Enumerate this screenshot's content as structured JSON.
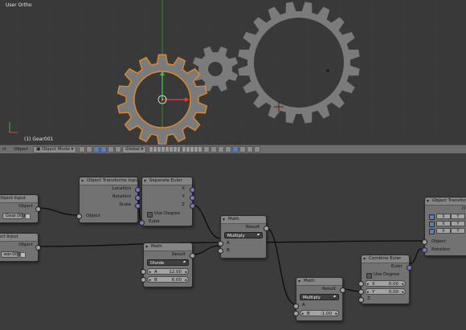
{
  "viewport": {
    "view_label": "User Ortho",
    "object_label": "(1) Gear001"
  },
  "header": {
    "menu_items": [
      "ct",
      "Object"
    ],
    "mode": "Object Mode",
    "orientation": "Global"
  },
  "nodes": {
    "object_input_1": {
      "title": "Object Input",
      "output": "Object",
      "value": "Gear.001"
    },
    "object_input_2": {
      "title": "ect Input",
      "output": "Object",
      "value": "ear.003"
    },
    "otin": {
      "title": "Object Transforms Input",
      "outputs": [
        "Location",
        "Rotation",
        "Scale"
      ],
      "input": "Object"
    },
    "separate_euler": {
      "title": "Separate Euler",
      "outputs": [
        "X",
        "Y",
        "Z"
      ],
      "checkbox": "Use Degree",
      "input": "Euler"
    },
    "math_divide": {
      "title": "Math",
      "output": "Result",
      "operation": "Divide",
      "a_label": "A",
      "a_value": "12.00",
      "b_label": "B",
      "b_value": "6.00"
    },
    "math_multiply_1": {
      "title": "Math",
      "output": "Result",
      "operation": "Multiply",
      "inputs": [
        "A",
        "B"
      ]
    },
    "math_multiply_2": {
      "title": "Math",
      "output": "Result",
      "operation": "Multiply",
      "a_label": "A",
      "b_label": "B",
      "b_value": "-1.00"
    },
    "combine_euler": {
      "title": "Combine Euler",
      "output": "Euler",
      "checkbox": "Use Degree",
      "x_label": "X",
      "x_value": "0.00",
      "y_label": "Y",
      "y_value": "0.00",
      "z_label": "Z"
    },
    "otout": {
      "title": "Object Transforms Out",
      "inputs": [
        "Object",
        "Rotation"
      ],
      "cells": [
        "X",
        "Y",
        "X",
        "Y",
        "X",
        "Y"
      ],
      "cut_label": "Ol"
    }
  }
}
